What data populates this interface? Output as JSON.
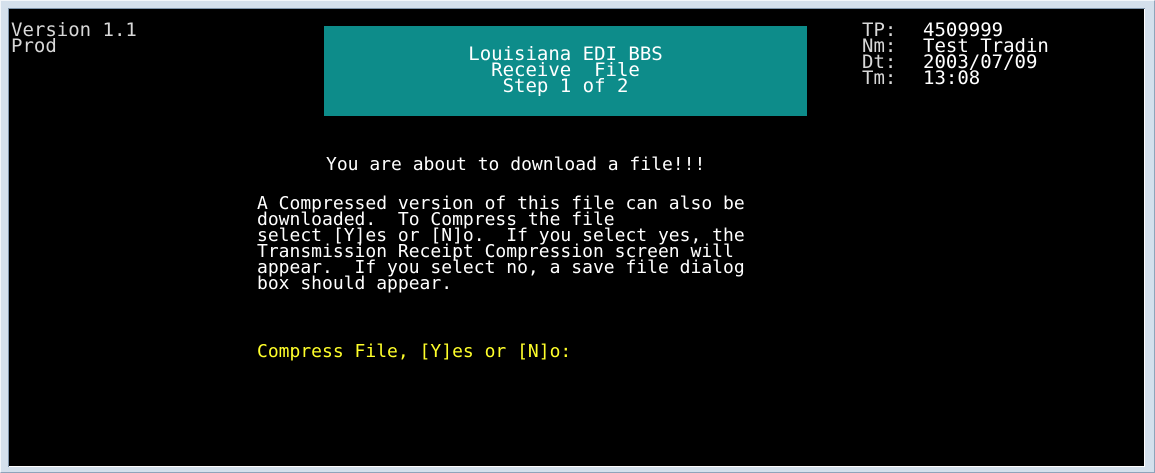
{
  "header": {
    "version": "Version 1.1",
    "environment": "Prod"
  },
  "title_box": {
    "line1": "Louisiana EDI BBS",
    "line2": "Receive  File",
    "line3": "Step 1 of 2",
    "background_color": "#0d8c8a"
  },
  "info": [
    {
      "label": "TP:",
      "value": "4509999"
    },
    {
      "label": "Nm:",
      "value": "Test Tradin"
    },
    {
      "label": "Dt:",
      "value": "2003/07/09"
    },
    {
      "label": "Tm:",
      "value": "13:08"
    }
  ],
  "main": {
    "headline": "You are about to download a file!!!",
    "body_lines": [
      "A Compressed version of this file can also be",
      "downloaded.  To Compress the file",
      "select [Y]es or [N]o.  If you select yes, the",
      "Transmission Receipt Compression screen will",
      "appear.  If you select no, a save file dialog",
      "box should appear."
    ],
    "prompt": "Compress File, [Y]es or [N]o:",
    "prompt_color": "#ffff2a"
  }
}
